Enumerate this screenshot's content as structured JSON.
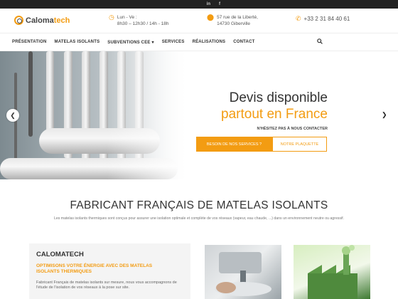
{
  "topbar": {
    "social": [
      "in",
      "f"
    ]
  },
  "logo": {
    "part1": "Caloma",
    "part2": "tech"
  },
  "header": {
    "hours_line1": "Lun - Ve :",
    "hours_line2": "8h30 – 12h30 / 14h - 18h",
    "address_line1": "57 rue de la Liberté,",
    "address_line2": "14730 Giberville",
    "phone": "+33 2 31 84 40 61"
  },
  "nav": {
    "items": [
      "PRÉSENTATION",
      "MATELAS ISOLANTS",
      "SUBVENTIONS CEE",
      "SERVICES",
      "RÉALISATIONS",
      "CONTACT"
    ],
    "subventions_arrow": "▾"
  },
  "hero": {
    "title1": "Devis disponible",
    "title2": "partout en France",
    "subtitle": "N'HÉSITEZ PAS À NOUS CONTACTER",
    "btn_primary": "BESOIN DE NOS SERVICES ?",
    "btn_secondary": "NOTRE PLAQUETTE",
    "prev_arrow": "❮",
    "next_arrow": "❯"
  },
  "section": {
    "title": "FABRICANT FRANÇAIS DE MATELAS ISOLANTS",
    "subtitle": "Les matelas isolants thermiques sont conçus pour assurer une isolation optimale et complète de vos réseaux (vapeur, eau chaude, ...) dans un environnement neutre ou agressif."
  },
  "card": {
    "title": "CALOMATECH",
    "subtitle": "OPTIMISONS VOTRE ÉNERGIE AVEC DES MATELAS ISOLANTS THERMIQUES",
    "text": "Fabricant Français de matelas isolants sur mesure, nous vous accompagnons de l'étude de l'isolation de vos réseaux à la pose sur site."
  },
  "colors": {
    "accent": "#f39c12",
    "topbar": "#222222"
  }
}
